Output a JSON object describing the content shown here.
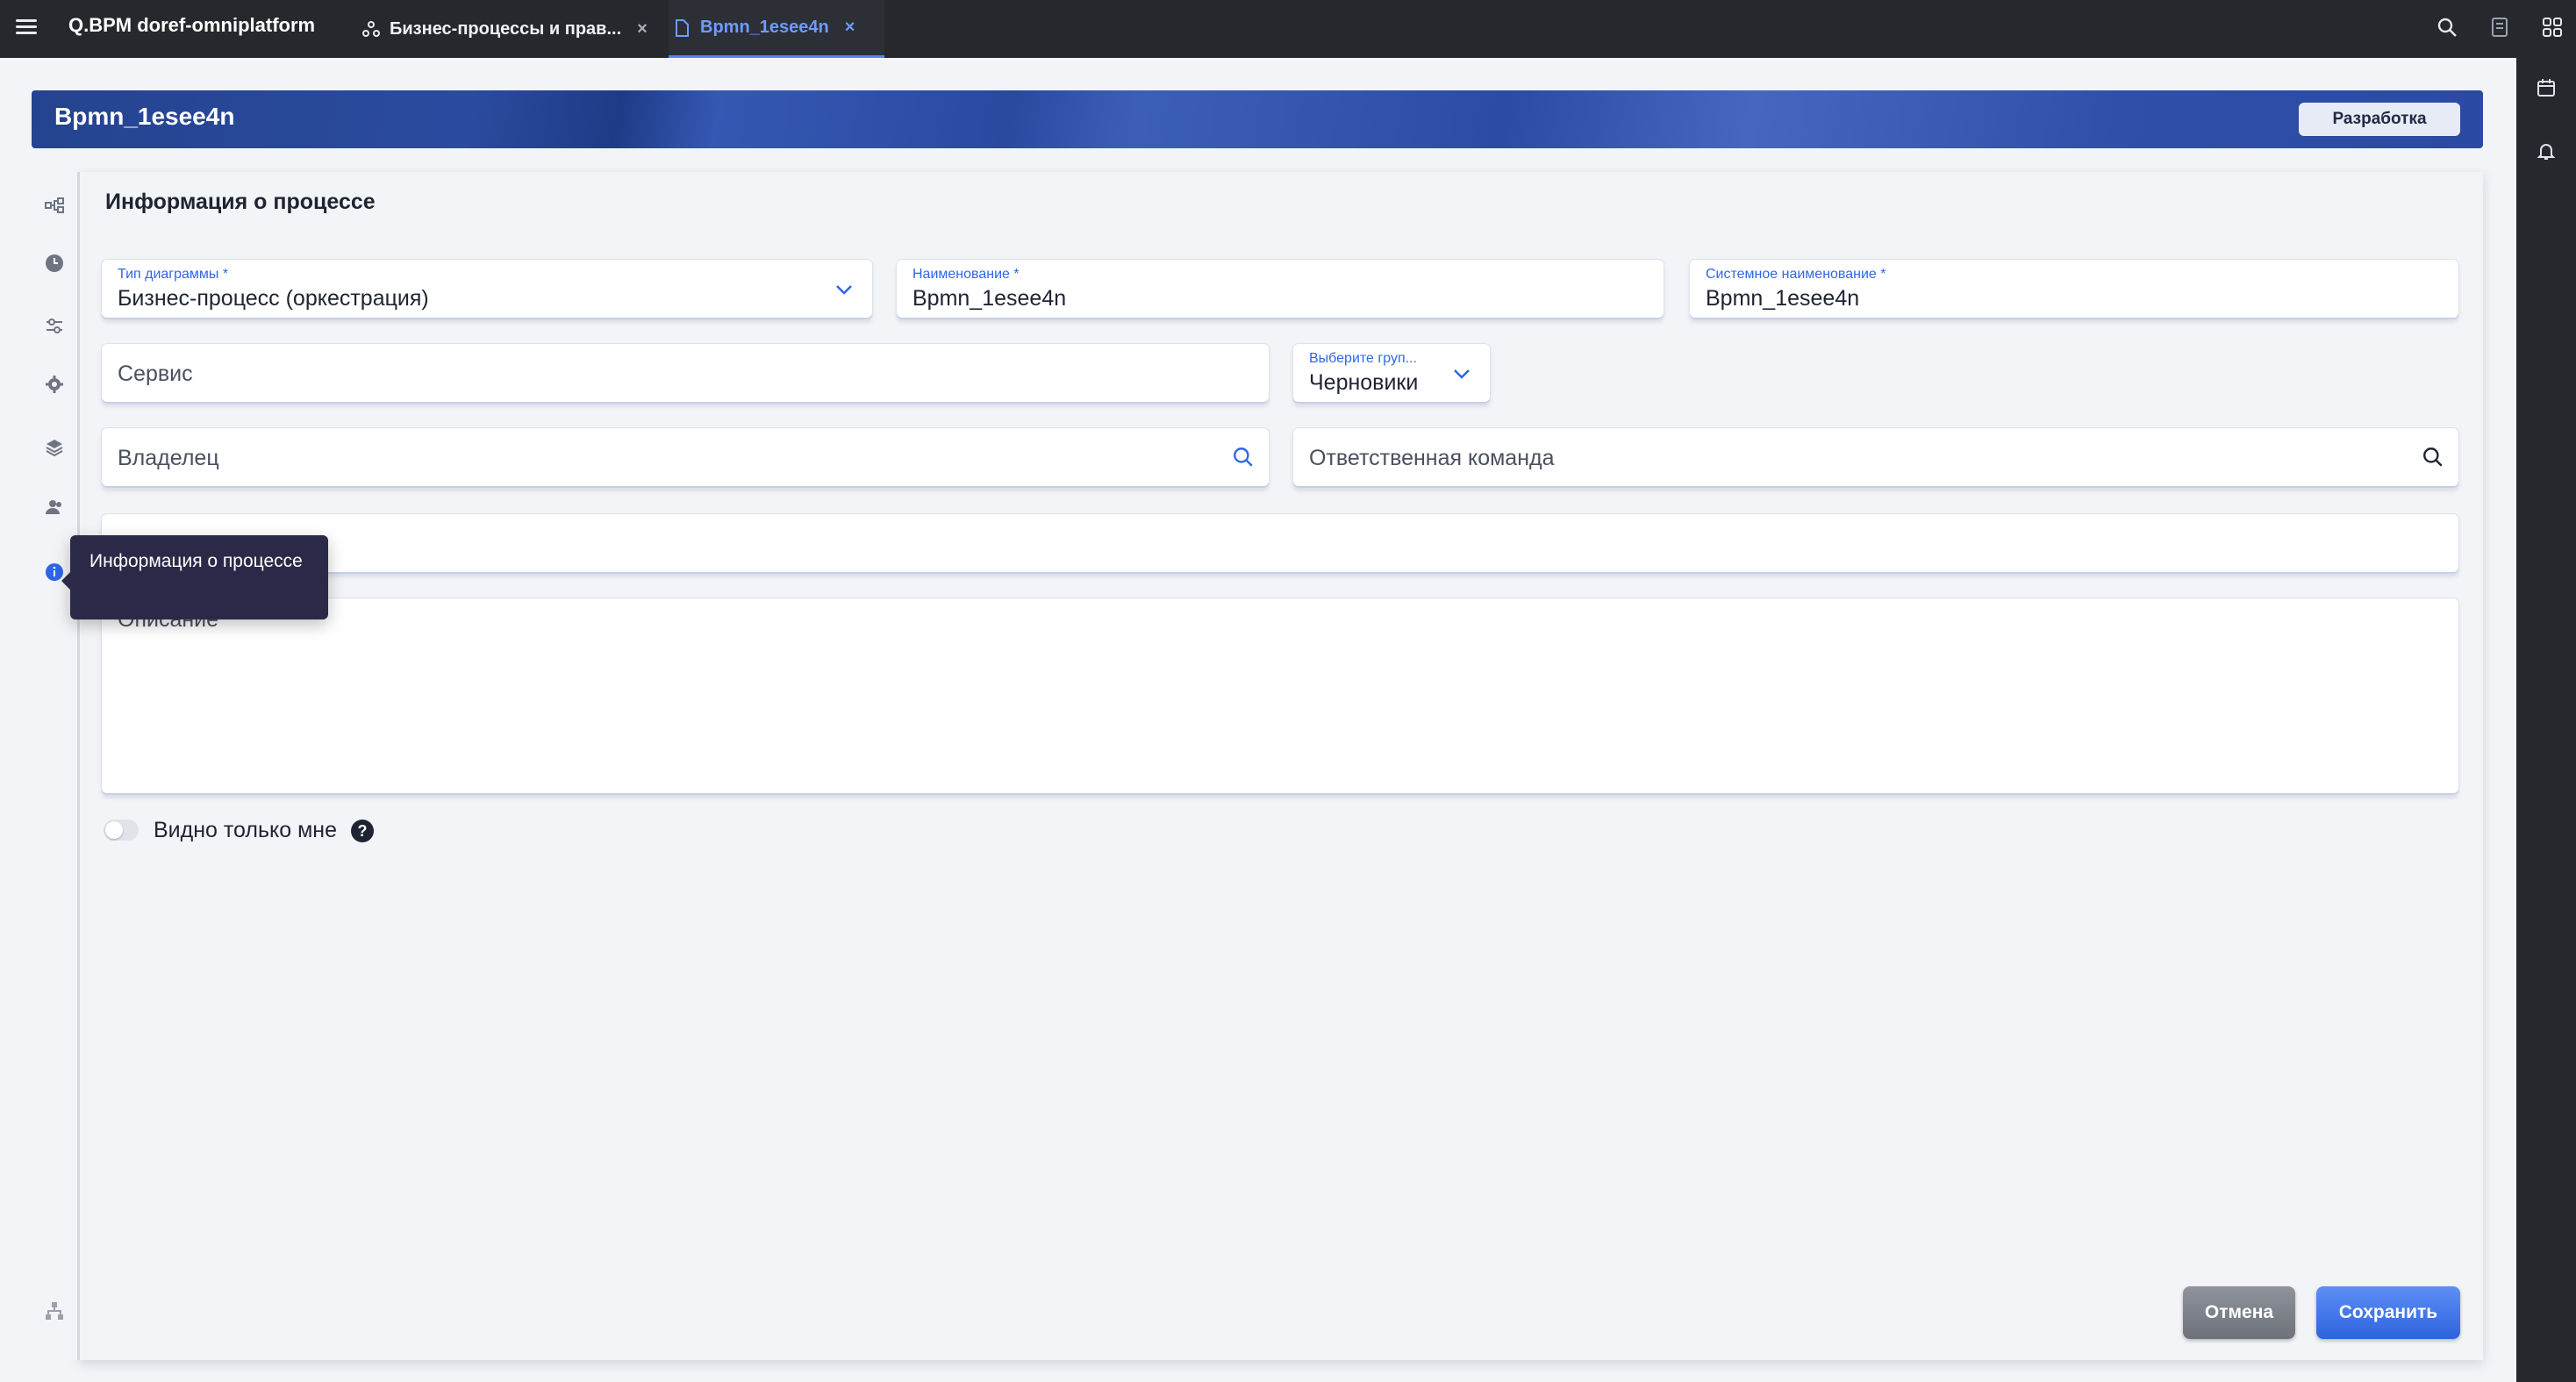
{
  "topbar": {
    "app_title": "Q.BPM doref-omniplatform",
    "tabs": [
      {
        "label": "Бизнес-процессы и прав...",
        "icon": "network-icon"
      },
      {
        "label": "Bpmn_1esee4n",
        "icon": "document-icon"
      }
    ],
    "close_glyph": "×",
    "right_icons": [
      "search-icon",
      "notes-icon",
      "apps-grid-icon"
    ]
  },
  "right_rail": {
    "icons": [
      "calendar-icon",
      "bell-icon"
    ]
  },
  "banner": {
    "title": "Bpmn_1esee4n",
    "badge": "Разработка"
  },
  "left_rail": {
    "icons": [
      "diagram-icon",
      "clock-icon",
      "sliders-icon",
      "gear-icon",
      "layers-icon",
      "users-icon",
      "info-icon",
      "hierarchy-icon"
    ],
    "active": "info-icon"
  },
  "form": {
    "section_title": "Информация о процессе",
    "diagram_type": {
      "label": "Тип диаграммы *",
      "value": "Бизнес-процесс (оркестрация)"
    },
    "name": {
      "label": "Наименование *",
      "value": "Bpmn_1esee4n"
    },
    "system_name": {
      "label": "Системное наименование *",
      "value": "Bpmn_1esee4n"
    },
    "service": {
      "placeholder": "Сервис"
    },
    "group": {
      "label": "Выберите груп...",
      "value": "Черновики"
    },
    "owner": {
      "placeholder": "Владелец"
    },
    "team": {
      "placeholder": "Ответственная команда"
    },
    "tags": {
      "placeholder": ""
    },
    "description": {
      "placeholder": "Описание"
    },
    "visible_only_me": {
      "label": "Видно только мне",
      "checked": false,
      "help": "?"
    }
  },
  "tooltip": {
    "text": "Информация о процессе"
  },
  "actions": {
    "cancel": "Отмена",
    "save": "Сохранить"
  },
  "colors": {
    "accent": "#2d67e8",
    "topbar": "#26282d",
    "tooltip": "#2a2a48"
  }
}
